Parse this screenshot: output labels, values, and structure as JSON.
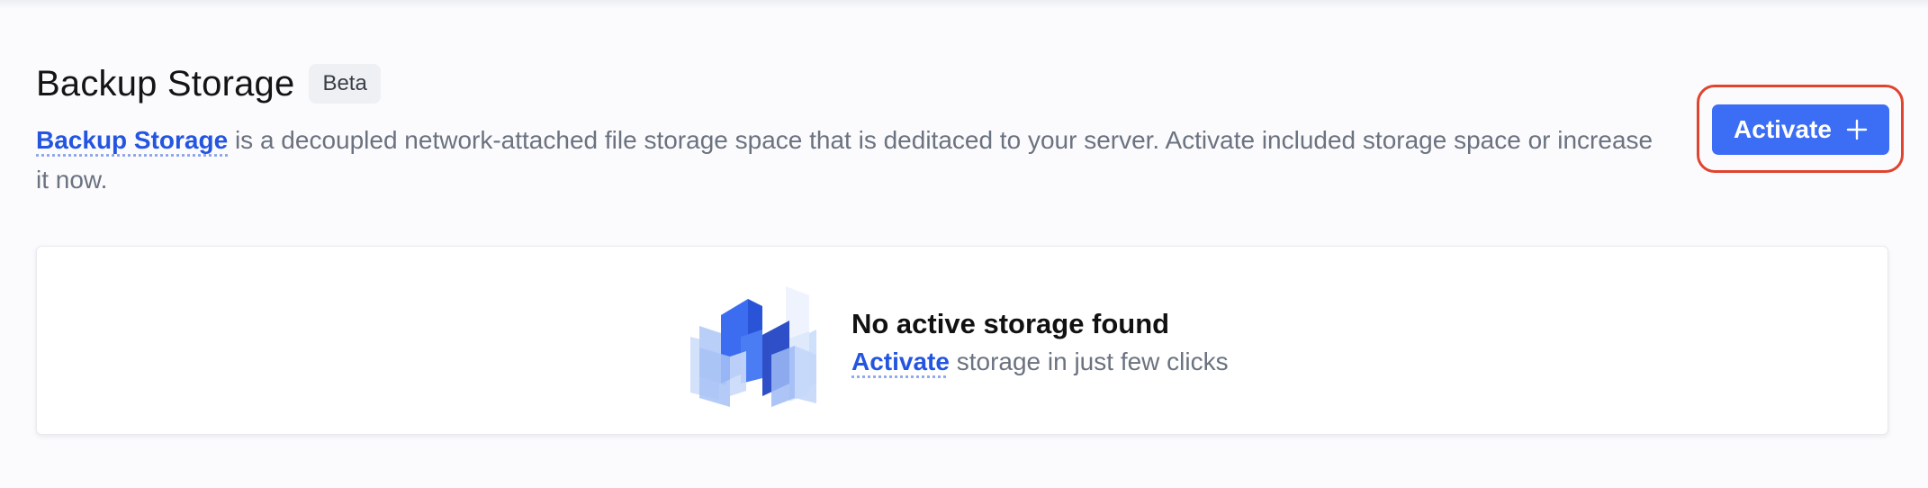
{
  "section": {
    "title": "Backup Storage",
    "badge": "Beta",
    "description_link": "Backup Storage",
    "description_text": " is a decoupled network-attached file storage space that is deditaced to your server. Activate included storage space or increase it now."
  },
  "toolbar": {
    "activate_label": "Activate",
    "activate_icon": "plus-icon"
  },
  "empty_state": {
    "title": "No active storage found",
    "link": "Activate",
    "text": " storage in just few clicks",
    "illustration_icon": "storage-blocks-icon"
  },
  "colors": {
    "accent": "#3b6ef5",
    "link": "#2455e0",
    "highlight": "#e0442f",
    "muted_text": "#6b7280"
  }
}
